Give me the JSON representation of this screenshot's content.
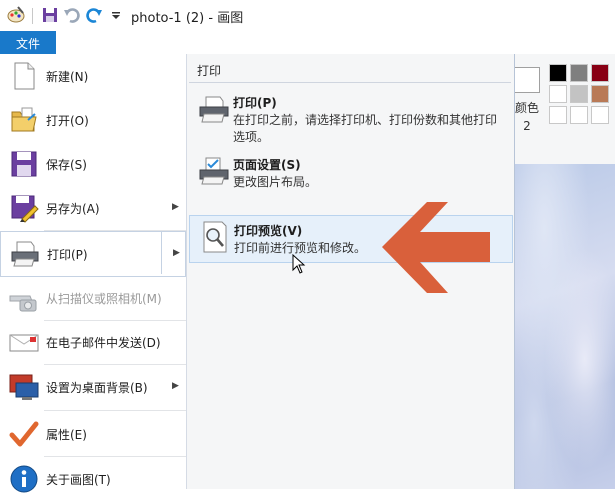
{
  "window": {
    "title": "photo-1 (2) - 画图"
  },
  "qat": {
    "icons": [
      "paint-app-icon",
      "save-icon",
      "undo-icon",
      "redo-icon",
      "customize-dropdown-icon"
    ]
  },
  "file_tab": {
    "label": "文件"
  },
  "menu": {
    "left_items": [
      {
        "name": "new",
        "label": "新建(N)",
        "icon": "new-file-icon",
        "disabled": false,
        "submenu": false
      },
      {
        "name": "open",
        "label": "打开(O)",
        "icon": "open-folder-icon",
        "disabled": false,
        "submenu": false
      },
      {
        "name": "save",
        "label": "保存(S)",
        "icon": "save-disk-icon",
        "disabled": false,
        "submenu": false
      },
      {
        "name": "save-as",
        "label": "另存为(A)",
        "icon": "save-as-icon",
        "disabled": false,
        "submenu": true
      },
      {
        "name": "print",
        "label": "打印(P)",
        "icon": "printer-icon",
        "disabled": false,
        "submenu": true
      },
      {
        "name": "scan",
        "label": "从扫描仪或照相机(M)",
        "icon": "scanner-camera-icon",
        "disabled": true,
        "submenu": false
      },
      {
        "name": "email",
        "label": "在电子邮件中发送(D)",
        "icon": "email-icon",
        "disabled": false,
        "submenu": false
      },
      {
        "name": "desktop-bg",
        "label": "设置为桌面背景(B)",
        "icon": "desktop-background-icon",
        "disabled": false,
        "submenu": true
      },
      {
        "name": "properties",
        "label": "属性(E)",
        "icon": "checkmark-icon",
        "disabled": false,
        "submenu": false
      },
      {
        "name": "about",
        "label": "关于画图(T)",
        "icon": "info-icon",
        "disabled": false,
        "submenu": false
      }
    ],
    "submenu": {
      "header": "打印",
      "items": [
        {
          "name": "print",
          "title": "打印(P)",
          "desc": "在打印之前，请选择打印机、打印份数和其他打印选项。",
          "icon": "printer-icon"
        },
        {
          "name": "page-setup",
          "title": "页面设置(S)",
          "desc": "更改图片布局。",
          "icon": "page-setup-icon"
        },
        {
          "name": "print-preview",
          "title": "打印预览(V)",
          "desc": "打印前进行预览和修改。",
          "icon": "print-preview-icon"
        }
      ]
    }
  },
  "ribbon": {
    "color2_label": "颜色 2",
    "palette": [
      "#000000",
      "#7f7f7f",
      "#880015",
      "#ffffff",
      "#c3c3c3",
      "#b97a57",
      "#ffffff",
      "#ffffff",
      "#ffffff"
    ]
  },
  "colors": {
    "accent": "#1979ca",
    "arrow": "#d9603b",
    "hover_bg": "#e6f0fa"
  }
}
